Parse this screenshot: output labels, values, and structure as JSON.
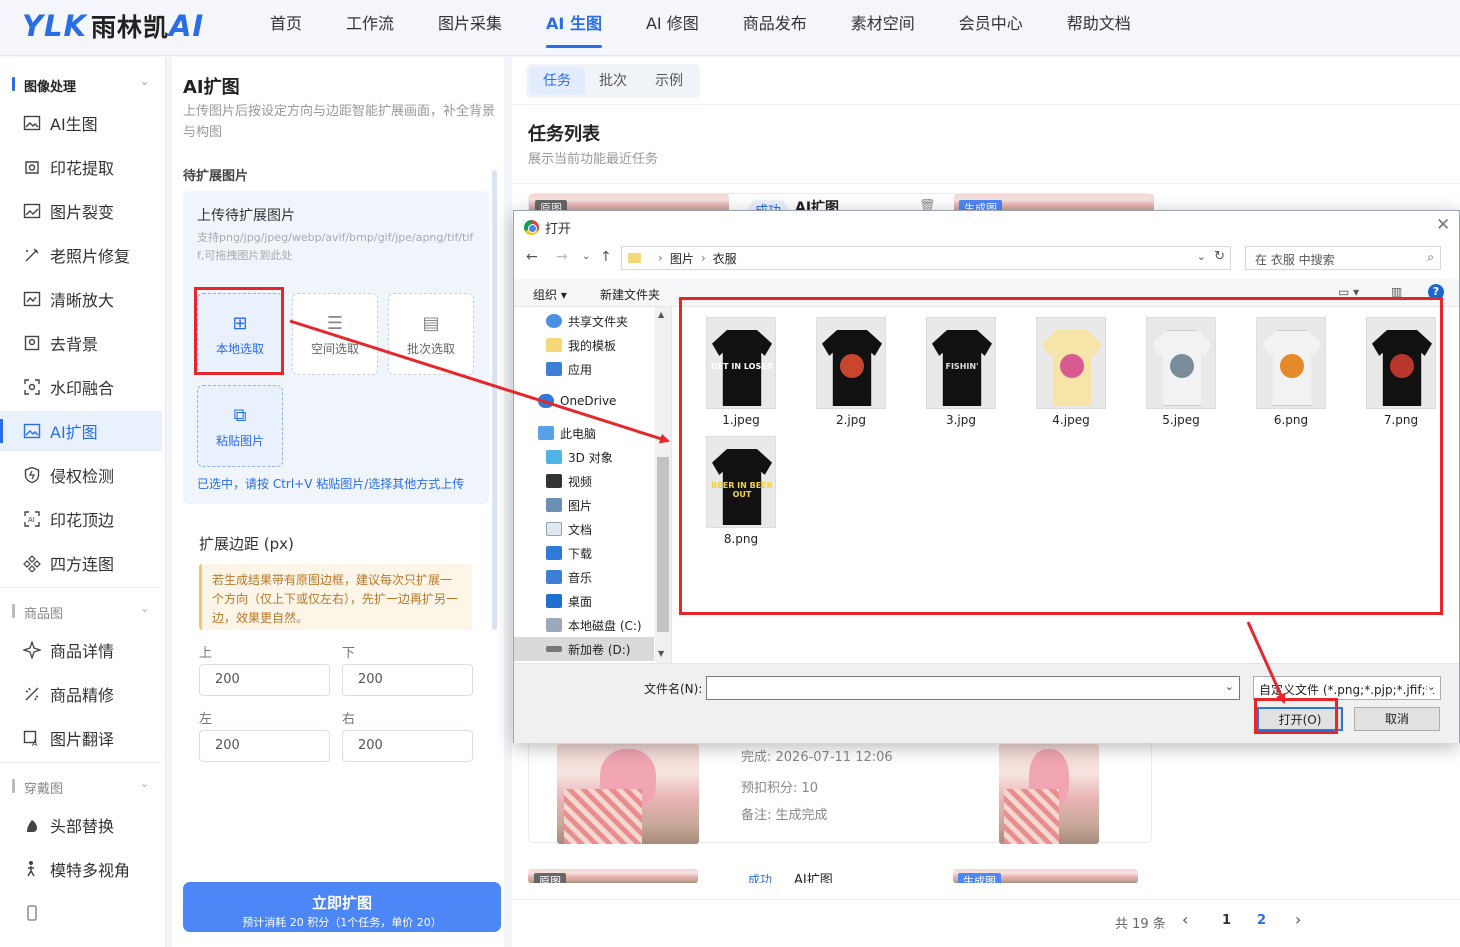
{
  "topbar": {
    "logo_text": "YLK",
    "logo_cn": "雨林凯",
    "logo_ai": "AI",
    "nav": [
      "首页",
      "工作流",
      "图片采集",
      "AI 生图",
      "AI 修图",
      "商品发布",
      "素材空间",
      "会员中心",
      "帮助文档"
    ],
    "nav_active_index": 3
  },
  "sidebar": {
    "groups": [
      {
        "title": "图像处理",
        "items": [
          "AI生图",
          "印花提取",
          "图片裂变",
          "老照片修复",
          "清晰放大",
          "去背景",
          "水印融合",
          "AI扩图",
          "侵权检测",
          "印花顶边",
          "四方连图"
        ]
      },
      {
        "title": "商品图",
        "items": [
          "商品详情",
          "商品精修",
          "图片翻译"
        ]
      },
      {
        "title": "穿戴图",
        "items": [
          "头部替换",
          "模特多视角"
        ]
      }
    ],
    "active_item": "AI扩图",
    "icons": [
      "image-ai-icon",
      "print-extract-icon",
      "image-split-icon",
      "photo-restore-icon",
      "upscale-icon",
      "remove-bg-icon",
      "watermark-icon",
      "expand-icon",
      "shield-check-icon",
      "print-edge-icon",
      "pattern-icon",
      "product-detail-icon",
      "retouch-icon",
      "translate-icon",
      "head-swap-icon",
      "multi-view-icon"
    ]
  },
  "mid": {
    "title": "AI扩图",
    "desc": "上传图片后按设定方向与边距智能扩展画面，补全背景与构图",
    "section": "待扩展图片",
    "upload_title": "上传待扩展图片",
    "upload_formats": "支持png/jpg/jpeg/webp/avif/bmp/gif/jpe/apng/tif/tiff,可拖拽图片到此处",
    "tiles": [
      "本地选取",
      "空间选取",
      "批次选取",
      "粘贴图片"
    ],
    "hint": "已选中，请按 Ctrl+V 粘贴图片/选择其他方式上传",
    "expand_title": "扩展边距 (px)",
    "warning": "若生成结果带有原图边框，建议每次只扩展一个方向（仅上下或仅左右），先扩一边再扩另一边，效果更自然。",
    "fields": [
      {
        "label": "上",
        "value": "200"
      },
      {
        "label": "下",
        "value": "200"
      },
      {
        "label": "左",
        "value": "200"
      },
      {
        "label": "右",
        "value": "200"
      }
    ],
    "button_main": "立即扩图",
    "button_sub": "预计消耗 20 积分（1个任务，单价 20）"
  },
  "right": {
    "tabs": [
      "任务",
      "批次",
      "示例"
    ],
    "active_tab": 0,
    "title": "任务列表",
    "desc": "展示当前功能最近任务",
    "task1": {
      "tag_orig": "原图",
      "status": "成功",
      "name": "AI扩图",
      "tag_gen": "生成图",
      "done": "完成: 2026-07-11 12:06",
      "points": "预扣积分: 10",
      "note": "备注: 生成完成"
    },
    "task2": {
      "tag_orig": "原图",
      "status": "成功",
      "name": "AI扩图",
      "tag_gen": "生成图"
    },
    "pager": {
      "total": "共 19 条",
      "pages": [
        "1",
        "2"
      ],
      "current": "2"
    }
  },
  "dialog": {
    "title": "打开",
    "path": [
      "图片",
      "衣服"
    ],
    "search_placeholder": "在 衣服 中搜索",
    "toolbar_organize": "组织 ▾",
    "toolbar_newfolder": "新建文件夹",
    "tree": [
      "共享文件夹",
      "我的模板",
      "应用",
      "OneDrive",
      "此电脑",
      "3D 对象",
      "视频",
      "图片",
      "文档",
      "下载",
      "音乐",
      "桌面",
      "本地磁盘 (C:)",
      "新加卷 (D:)"
    ],
    "tree_selected": "新加卷 (D:)",
    "files": [
      "1.jpeg",
      "2.jpg",
      "3.jpg",
      "4.jpeg",
      "5.jpeg",
      "6.png",
      "7.png",
      "8.png"
    ],
    "filename_label": "文件名(N):",
    "filename_value": "",
    "filetype": "自定义文件 (*.png;*.pjp;*.jfif;*.",
    "open_button": "打开(O)",
    "cancel_button": "取消"
  },
  "colors": {
    "accent": "#2a6de8",
    "highlight": "#e5262b",
    "button": "#4d86f7"
  }
}
